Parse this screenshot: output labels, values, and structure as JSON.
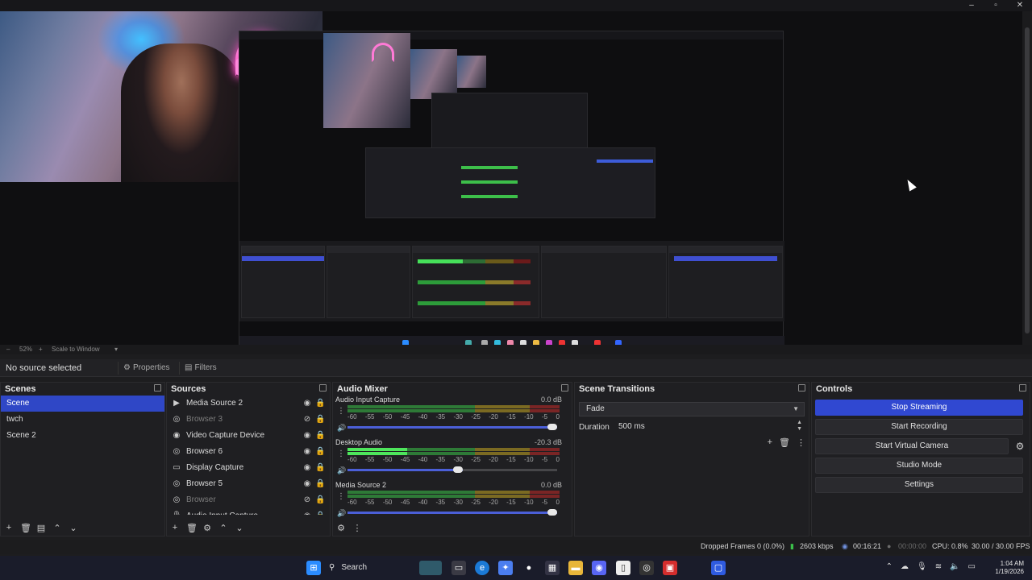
{
  "preview": {
    "zoom": "52%",
    "scale_mode": "Scale to Window"
  },
  "context_bar": {
    "no_source": "No source selected",
    "properties": "Properties",
    "filters": "Filters"
  },
  "scenes": {
    "title": "Scenes",
    "items": [
      "Scene",
      "twch",
      "Scene 2"
    ],
    "selected": "Scene"
  },
  "sources": {
    "title": "Sources",
    "items": [
      {
        "name": "Media Source 2",
        "icon": "play-icon",
        "visible": true
      },
      {
        "name": "Browser 3",
        "icon": "browser-icon",
        "visible": false
      },
      {
        "name": "Video Capture Device",
        "icon": "camera-icon",
        "visible": true
      },
      {
        "name": "Browser 6",
        "icon": "browser-icon",
        "visible": true
      },
      {
        "name": "Display Capture",
        "icon": "monitor-icon",
        "visible": true
      },
      {
        "name": "Browser 5",
        "icon": "browser-icon",
        "visible": true
      },
      {
        "name": "Browser",
        "icon": "browser-icon",
        "visible": false
      },
      {
        "name": "Audio Input Capture",
        "icon": "mic-icon",
        "visible": true
      }
    ]
  },
  "audio_mixer": {
    "title": "Audio Mixer",
    "scale": [
      "-60",
      "-55",
      "-50",
      "-45",
      "-40",
      "-35",
      "-30",
      "-25",
      "-20",
      "-15",
      "-10",
      "-5",
      "0"
    ],
    "channels": [
      {
        "name": "Audio Input Capture",
        "db": "0.0 dB",
        "level": 0.0,
        "volume": 1.0
      },
      {
        "name": "Desktop Audio",
        "db": "-20.3 dB",
        "level": 0.28,
        "volume": 0.55
      },
      {
        "name": "Media Source 2",
        "db": "0.0 dB",
        "level": 0.0,
        "volume": 1.0
      }
    ]
  },
  "scene_transitions": {
    "title": "Scene Transitions",
    "transition": "Fade",
    "duration_label": "Duration",
    "duration_value": "500 ms"
  },
  "controls": {
    "title": "Controls",
    "stop_streaming": "Stop Streaming",
    "start_recording": "Start Recording",
    "start_virtual_camera": "Start Virtual Camera",
    "studio_mode": "Studio Mode",
    "settings": "Settings"
  },
  "status": {
    "dropped_frames": "Dropped Frames 0 (0.0%)",
    "bitrate": "2603 kbps",
    "stream_time": "00:16:21",
    "rec_time": "00:00:00",
    "cpu": "CPU: 0.8%",
    "fps": "30.00 / 30.00 FPS"
  },
  "taskbar": {
    "search": "Search",
    "time": "1:04 AM",
    "date": "1/19/2026"
  },
  "colors": {
    "accent": "#3048d1",
    "meter_green": "#4ee65c",
    "meter_yellow": "#7b6a22",
    "meter_red": "#7a2525"
  }
}
